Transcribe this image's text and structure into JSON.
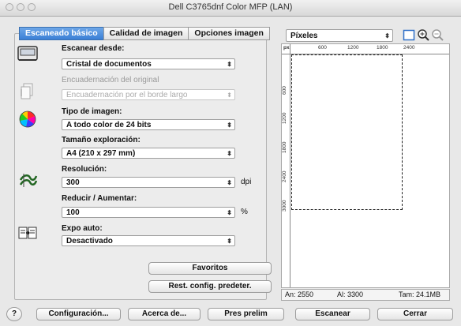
{
  "window": {
    "title": "Dell C3765dnf Color MFP (LAN)"
  },
  "tabs": [
    {
      "label": "Escaneado básico",
      "active": true
    },
    {
      "label": "Calidad de imagen",
      "active": false
    },
    {
      "label": "Opciones imagen",
      "active": false
    }
  ],
  "fields": {
    "scan_from": {
      "label": "Escanear desde:",
      "value": "Cristal de documentos"
    },
    "binding": {
      "label": "Encuadernación del original",
      "value": "Encuadernación por el borde largo"
    },
    "image_type": {
      "label": "Tipo de imagen:",
      "value": "A todo color de 24 bits"
    },
    "scan_size": {
      "label": "Tamaño exploración:",
      "value": "A4 (210 x 297 mm)"
    },
    "resolution": {
      "label": "Resolución:",
      "value": "300",
      "unit": "dpi"
    },
    "reduce_enlarge": {
      "label": "Reducir / Aumentar:",
      "value": "100",
      "unit": "%"
    },
    "auto_expo": {
      "label": "Expo auto:",
      "value": "Desactivado"
    }
  },
  "buttons": {
    "favorites": "Favoritos",
    "reset_defaults": "Rest. config. predeter.",
    "help": "?",
    "configuration": "Configuración...",
    "about": "Acerca de...",
    "preview": "Pres prelim",
    "scan": "Escanear",
    "close": "Cerrar"
  },
  "preview": {
    "unit_select": "Píxeles",
    "ruler_unit": "px",
    "ruler_h": [
      "600",
      "1200",
      "1800",
      "2400"
    ],
    "ruler_v": [
      "600",
      "1200",
      "1800",
      "2400",
      "3000"
    ]
  },
  "status": {
    "width": "An: 2550",
    "height": "Al: 3300",
    "size": "Tam: 24.1MB"
  },
  "icons": {
    "scanner": "scanner-icon",
    "binding": "binding-icon",
    "color": "color-wheel-icon",
    "resolution": "resolution-icon",
    "exposure": "exposure-icon",
    "frame": "frame-icon",
    "zoom_in": "zoom-in-icon",
    "zoom_out": "zoom-out-icon"
  }
}
